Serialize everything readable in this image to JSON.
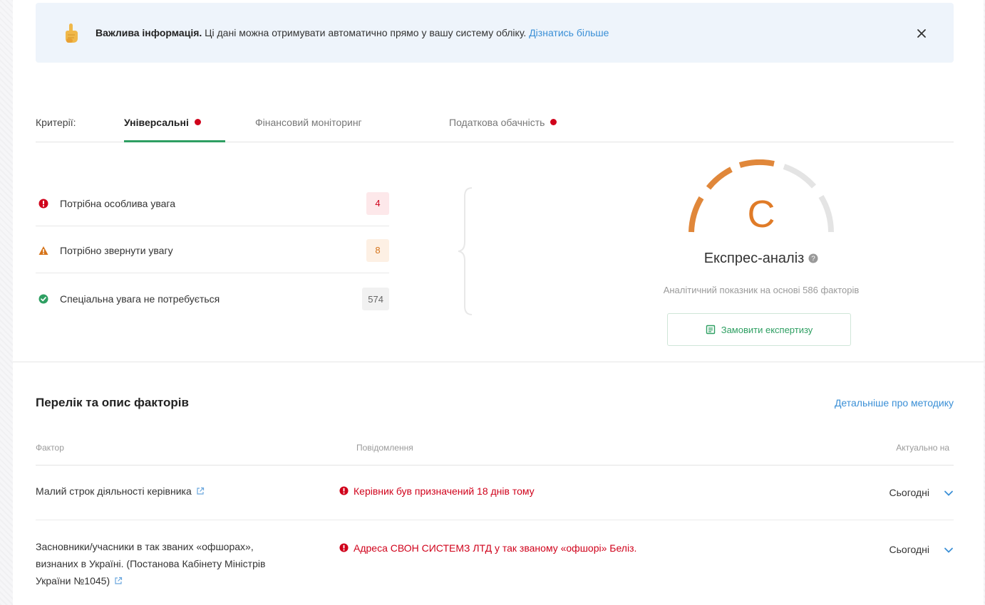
{
  "banner": {
    "bold": "Важлива інформація.",
    "text": " Ці дані можна отримувати автоматично прямо у вашу систему обліку. ",
    "link": "Дізнатись більше"
  },
  "tabs": {
    "label": "Критерії:",
    "items": [
      {
        "label": "Універсальні",
        "active": true,
        "dot": true
      },
      {
        "label": "Фінансовий моніторинг",
        "active": false,
        "dot": false
      },
      {
        "label": "Податкова обачність",
        "active": false,
        "dot": true
      }
    ]
  },
  "summary": [
    {
      "label": "Потрібна особлива увага",
      "count": "4",
      "icon": "alert-circle-icon"
    },
    {
      "label": "Потрібно звернути увагу",
      "count": "8",
      "icon": "warning-triangle-icon"
    },
    {
      "label": "Спеціальна увага не потребується",
      "count": "574",
      "icon": "check-circle-icon"
    }
  ],
  "express": {
    "grade": "C",
    "title": "Експрес-аналіз",
    "subtitle": "Аналітичний показник на основі 586 факторів",
    "button": "Замовити експертизу",
    "colors": {
      "active": "#e0873a",
      "inactive": "#e4e4e4"
    }
  },
  "factors": {
    "title": "Перелік та опис факторів",
    "link": "Детальніше про методику",
    "headers": {
      "factor": "Фактор",
      "message": "Повідомлення",
      "date": "Актуально на"
    },
    "rows": [
      {
        "name": "Малий строк діяльності керівника",
        "message": "Керівник був призначений 18 днів тому",
        "date": "Сьогодні"
      },
      {
        "name": "Засновники/учасники в так званих «офшорах», визнаних в Україні. (Постанова Кабінету Міністрів України №1045)",
        "message": "Адреса СВОН СИСТЕМЗ ЛТД у так званому «офшорі» Беліз.",
        "date": "Сьогодні"
      }
    ]
  },
  "colors": {
    "accent": "#2e9f62",
    "danger": "#d0021b",
    "warning": "#d6741a",
    "link": "#3a8fd6"
  }
}
